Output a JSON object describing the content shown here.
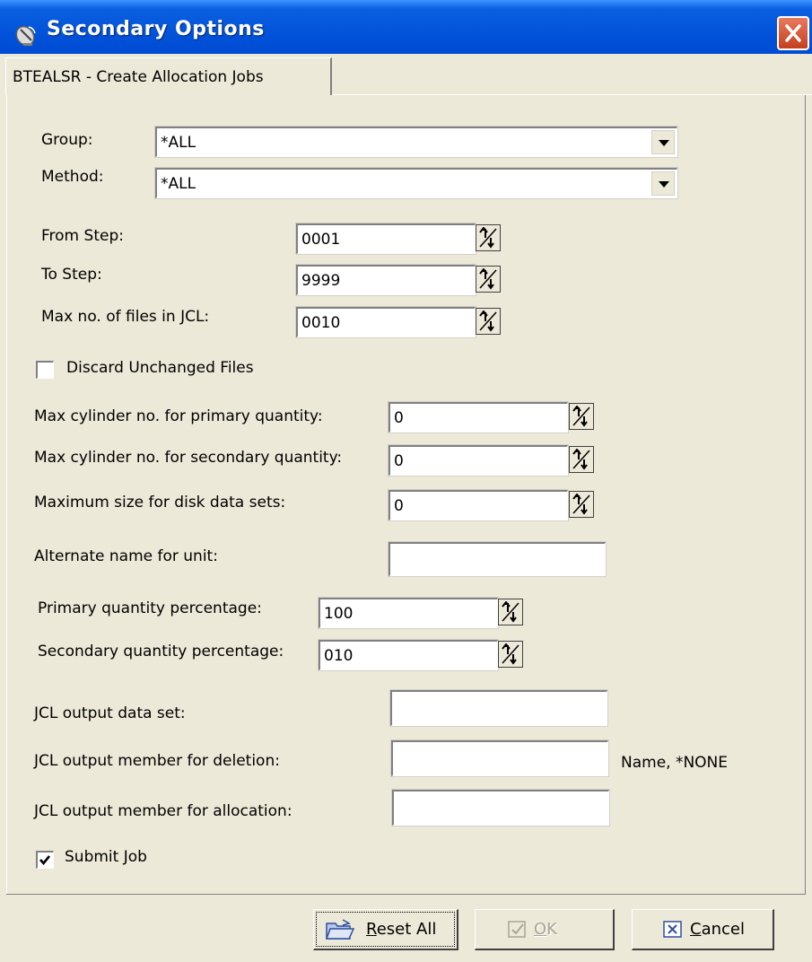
{
  "window": {
    "title": "Secondary Options",
    "accent": "#0151d8"
  },
  "icons": {
    "title": "satellite-dish-icon",
    "close": "close-icon",
    "dropdown": "chevron-down-icon",
    "spin": "spin-updown-icon",
    "reset": "folder-reset-icon",
    "ok": "check-icon",
    "cancel": "cancel-x-icon"
  },
  "tab": {
    "label": "BTEALSR - Create Allocation Jobs"
  },
  "form": {
    "group": {
      "label": "Group:",
      "value": "*ALL"
    },
    "method": {
      "label": "Method:",
      "value": "*ALL"
    },
    "from_step": {
      "label": "From Step:",
      "value": "0001"
    },
    "to_step": {
      "label": "To Step:",
      "value": "9999"
    },
    "max_files": {
      "label": "Max no. of files in JCL:",
      "value": "0010"
    },
    "discard": {
      "label": "Discard Unchanged Files",
      "checked": false
    },
    "max_cyl_primary": {
      "label": "Max cylinder no. for primary quantity:",
      "value": "0"
    },
    "max_cyl_secondary": {
      "label": "Max cylinder no. for secondary quantity:",
      "value": "0"
    },
    "max_disk_size": {
      "label": "Maximum size for disk data sets:",
      "value": "0"
    },
    "alt_unit": {
      "label": "Alternate name for unit:",
      "value": ""
    },
    "primary_pct": {
      "label": "Primary quantity percentage:",
      "value": "100"
    },
    "secondary_pct": {
      "label": "Secondary quantity percentage:",
      "value": "010"
    },
    "jcl_dataset": {
      "label": "JCL output data set:",
      "value": ""
    },
    "jcl_member_delete": {
      "label": "JCL output member for deletion:",
      "value": "",
      "hint": "Name, *NONE"
    },
    "jcl_member_alloc": {
      "label": "JCL output member for allocation:",
      "value": ""
    },
    "submit": {
      "label": "Submit Job",
      "checked": true
    }
  },
  "buttons": {
    "reset": {
      "prefix": "R",
      "rest": "eset All"
    },
    "ok": {
      "prefix": "O",
      "rest": "K",
      "enabled": false
    },
    "cancel": {
      "prefix": "C",
      "rest": "ancel"
    }
  }
}
